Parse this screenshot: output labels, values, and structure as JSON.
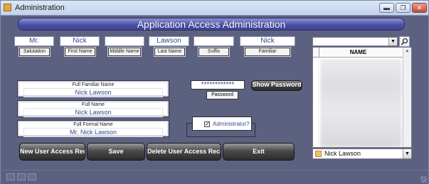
{
  "window": {
    "title": "Administration",
    "controls": {
      "minimize": "▬",
      "restore": "❐",
      "close": "✕"
    }
  },
  "header": {
    "title": "Application Access Administration"
  },
  "name_fields": [
    {
      "value": "Mr.",
      "label": "Salutation"
    },
    {
      "value": "Nick",
      "label": "First Name"
    },
    {
      "value": "",
      "label": "Middle Name"
    },
    {
      "value": "Lawson",
      "label": "Last Name"
    },
    {
      "value": "",
      "label": "Suffix"
    },
    {
      "value": "Nick",
      "label": "Familiar"
    }
  ],
  "full_names": {
    "familiar": {
      "label": "Full Familiar Name",
      "value": "Nick Lawson"
    },
    "full": {
      "label": "Full Name",
      "value": "Nick Lawson"
    },
    "formal": {
      "label": "Full Formal Name",
      "value": "Mr. Nick  Lawson"
    }
  },
  "password": {
    "value": "************",
    "label": "Password",
    "show_button": "Show Password"
  },
  "administrator": {
    "label": "Administrator?",
    "checked": true,
    "check_glyph": "✓"
  },
  "actions": {
    "new": "New User Access Record",
    "save": "Save",
    "delete": "Delete User Access Record",
    "exit": "Exit"
  },
  "search": {
    "value": "",
    "arrow": "▼",
    "button_icon": "search-icon"
  },
  "list": {
    "column_header": "NAME",
    "scroll_up": "▲"
  },
  "selected_user": {
    "name": "Nick Lawson",
    "arrow": "▼"
  },
  "colors": {
    "window_bg": "#5d6180",
    "header_bar": "#4b51a6",
    "button_dark": "#2c2c2c",
    "field_text": "#3a4a8a"
  }
}
